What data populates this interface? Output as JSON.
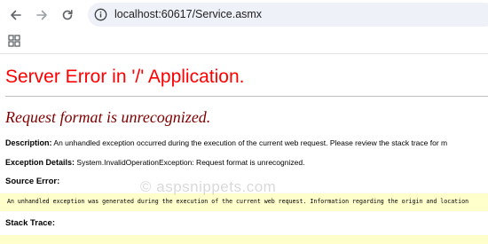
{
  "browser": {
    "url": "localhost:60617/Service.asmx",
    "icons": {
      "back": "arrow-left-icon",
      "forward": "arrow-right-icon",
      "reload": "reload-icon",
      "site_info": "info-icon",
      "apps": "apps-grid-icon"
    }
  },
  "error_page": {
    "title": "Server Error in '/' Application.",
    "message": "Request format is unrecognized.",
    "description_label": "Description:",
    "description_text": "An unhandled exception occurred during the execution of the current web request. Please review the stack trace for m",
    "exception_label": "Exception Details:",
    "exception_text": "System.InvalidOperationException: Request format is unrecognized.",
    "source_error_label": "Source Error:",
    "source_error_text": "An unhandled exception was generated during the execution of the current web request. Information regarding the origin and location",
    "stack_trace_label": "Stack Trace:",
    "colors": {
      "title": "#ff0000",
      "message": "#800000",
      "code_bg": "#ffffcc"
    }
  },
  "watermark": "© aspsnippets.com"
}
